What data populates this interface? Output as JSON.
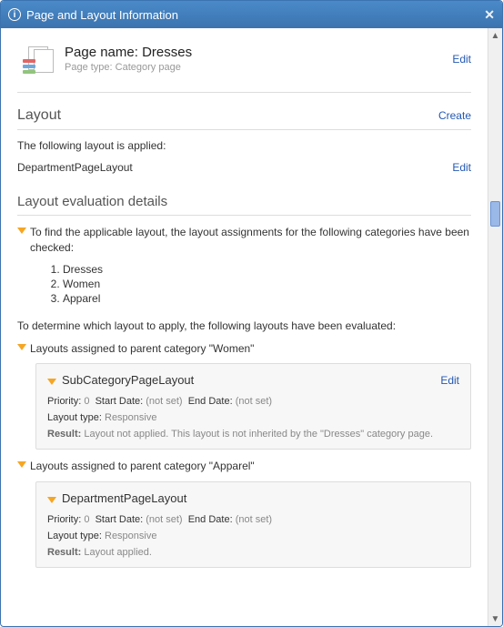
{
  "dialog": {
    "title": "Page and Layout Information"
  },
  "page": {
    "name_label": "Page name:",
    "name": "Dresses",
    "type_label": "Page type:",
    "type": "Category page",
    "edit": "Edit"
  },
  "layout": {
    "heading": "Layout",
    "create": "Create",
    "applied_text": "The following layout is applied:",
    "name": "DepartmentPageLayout",
    "edit": "Edit"
  },
  "eval": {
    "heading": "Layout evaluation details",
    "find_text": "To find the applicable layout, the layout assignments for the following categories have been checked:",
    "categories": [
      "Dresses",
      "Women",
      "Apparel"
    ],
    "determine_text": "To determine which layout to apply, the following layouts have been evaluated:",
    "groups": [
      {
        "label": "Layouts assigned to parent category \"Women\"",
        "layouts": [
          {
            "name": "SubCategoryPageLayout",
            "edit": "Edit",
            "priority_label": "Priority:",
            "priority": "0",
            "start_label": "Start Date:",
            "start": "(not set)",
            "end_label": "End Date:",
            "end": "(not set)",
            "type_label": "Layout type:",
            "type": "Responsive",
            "result_label": "Result:",
            "result": "Layout not applied. This layout is not inherited by the \"Dresses\" category page."
          }
        ]
      },
      {
        "label": "Layouts assigned to parent category \"Apparel\"",
        "layouts": [
          {
            "name": "DepartmentPageLayout",
            "edit": "",
            "priority_label": "Priority:",
            "priority": "0",
            "start_label": "Start Date:",
            "start": "(not set)",
            "end_label": "End Date:",
            "end": "(not set)",
            "type_label": "Layout type:",
            "type": "Responsive",
            "result_label": "Result:",
            "result": "Layout applied."
          }
        ]
      }
    ]
  }
}
